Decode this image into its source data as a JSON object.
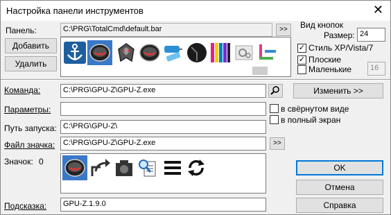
{
  "window": {
    "title": "Настройка панели инструментов",
    "close_glyph": "✕"
  },
  "panel": {
    "label": "Панель:",
    "path": "C:\\PRG\\TotalCmd\\default.bar",
    "browse": ">>"
  },
  "buttons_left": {
    "add": "Добавить",
    "remove": "Удалить"
  },
  "view": {
    "group_label": "Вид кнопок",
    "size_label": "Размер:",
    "size_value": "24",
    "style_label": "Стиль XP/Vista/7",
    "flat_label": "Плоские",
    "small_label": "Маленькие",
    "small_value": "16",
    "style_checked": "✓",
    "flat_checked": "✓"
  },
  "command": {
    "label": "Команда:",
    "value": "C:\\PRG\\GPU-Z\\GPU-Z.exe",
    "change": "Изменить >>"
  },
  "params": {
    "label": "Параметры:",
    "value": "",
    "minimized": "в свёрнутом виде",
    "fullscreen": "в полный экран"
  },
  "startpath": {
    "label": "Путь запуска:",
    "value": "C:\\PRG\\GPU-Z\\"
  },
  "iconfile": {
    "label": "Файл значка:",
    "value": "C:\\PRG\\GPU-Z\\GPU-Z.exe",
    "browse": ">>"
  },
  "icon": {
    "label": "Значок:",
    "index": "0"
  },
  "tooltip": {
    "label": "Подсказка:",
    "value": "GPU-Z.1.9.0"
  },
  "actions": {
    "ok": "OK",
    "cancel": "Отмена",
    "help": "Справка"
  },
  "toolbar_icons": [
    "anchor-icon",
    "gpu-z-icon",
    "witcher-wolf-icon",
    "gpu-z-icon",
    "paint-roller-icon",
    "dark-disc-icon",
    "color-bars-icon",
    "settings-gears-icon",
    "code-icon"
  ],
  "icon_choices": [
    "gpu-z-icon",
    "share-arrow-icon",
    "camera-icon",
    "magnifier-document-icon",
    "menu-lines-icon",
    "refresh-icon"
  ]
}
